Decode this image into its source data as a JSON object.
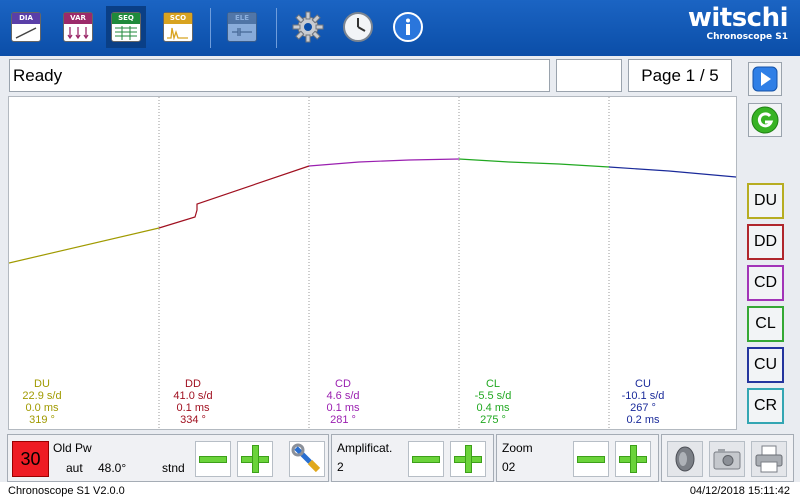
{
  "toolbar": {
    "buttons": [
      {
        "tag": "DIA",
        "color": "#5a3fa8"
      },
      {
        "tag": "VAR",
        "color": "#9c2a6a"
      },
      {
        "tag": "SEQ",
        "color": "#1f8a3b"
      },
      {
        "tag": "SCO",
        "color": "#d8a320"
      },
      {
        "tag": "ELE",
        "color": "#8c8f96"
      }
    ],
    "icons": [
      "gear-icon",
      "clock-icon",
      "info-icon"
    ],
    "logo": {
      "main": "witschi",
      "sub": "Chronoscope S1"
    }
  },
  "status": {
    "text": "Ready",
    "page": "Page 1 / 5"
  },
  "positions": [
    {
      "code": "DU",
      "rate": "22.9 s/d",
      "ms": "0.0 ms",
      "amp": "319 °",
      "color": "#a09a00"
    },
    {
      "code": "DD",
      "rate": "41.0 s/d",
      "ms": "0.1 ms",
      "amp": "334 °",
      "color": "#a01020"
    },
    {
      "code": "CD",
      "rate": "4.6 s/d",
      "ms": "0.1 ms",
      "amp": "281 °",
      "color": "#9a1fb0"
    },
    {
      "code": "CL",
      "rate": "-5.5 s/d",
      "ms": "0.4 ms",
      "amp": "275 °",
      "color": "#21a821"
    },
    {
      "code": "CU",
      "rate": "-10.1 s/d",
      "amp": "267 °",
      "ms": "0.2 ms",
      "color": "#1a2a9a"
    }
  ],
  "side_buttons": [
    {
      "label": "DU",
      "color": "#b7ad21"
    },
    {
      "label": "DD",
      "color": "#b0262c"
    },
    {
      "label": "CD",
      "color": "#a234b8"
    },
    {
      "label": "CL",
      "color": "#34a834"
    },
    {
      "label": "CU",
      "color": "#23349e"
    },
    {
      "label": "CR",
      "color": "#33a6b3"
    }
  ],
  "bottom": {
    "beat_value": "30",
    "mode": "Old Pw",
    "lift_mode": "aut",
    "lift_angle": "48.0°",
    "standard": "stnd",
    "amplification_label": "Amplificat.",
    "amplification_value": "2",
    "zoom_label": "Zoom",
    "zoom_value": "02"
  },
  "footer": {
    "version": "Chronoscope S1 V2.0.0",
    "datetime": "04/12/2018 15:11:42"
  }
}
